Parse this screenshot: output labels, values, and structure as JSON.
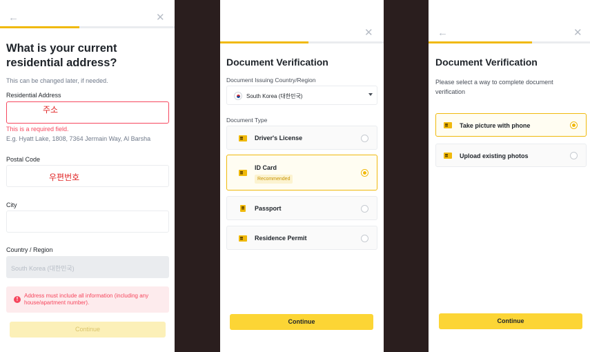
{
  "address_form": {
    "title": "What is your current residential address?",
    "subtitle": "This can be changed later, if needed.",
    "fields": {
      "address": {
        "label": "Residential Address",
        "value": "주소",
        "error": "This is a required field.",
        "hint": "E.g. Hyatt Lake, 1808, 7364 Jermain Way, Al Barsha"
      },
      "postal": {
        "label": "Postal Code",
        "value": "우편번호"
      },
      "city": {
        "label": "City",
        "value": ""
      },
      "country": {
        "label": "Country / Region",
        "value": "South Korea (대한민국)"
      }
    },
    "alert": "Address must include all information (including any house/apartment number).",
    "continue": "Continue"
  },
  "doc_type": {
    "title": "Document Verification",
    "country_label": "Document Issuing Country/Region",
    "country_value": "South Korea (대한민국)",
    "type_label": "Document Type",
    "options": [
      {
        "label": "Driver's License",
        "icon": "drivers-license-icon",
        "selected": false
      },
      {
        "label": "ID Card",
        "icon": "id-card-icon",
        "selected": true,
        "badge": "Recommended"
      },
      {
        "label": "Passport",
        "icon": "passport-icon",
        "selected": false
      },
      {
        "label": "Residence Permit",
        "icon": "residence-permit-icon",
        "selected": false
      }
    ],
    "continue": "Continue"
  },
  "method": {
    "title": "Document Verification",
    "description": "Please select a way to complete document verification",
    "options": [
      {
        "label": "Take picture with phone",
        "icon": "camera-icon",
        "selected": true
      },
      {
        "label": "Upload existing photos",
        "icon": "upload-icon",
        "selected": false
      }
    ],
    "continue": "Continue"
  },
  "colors": {
    "accent": "#F0B90B",
    "button": "#FCD535",
    "error": "#F6465D",
    "divider": "#2A1E1E"
  }
}
